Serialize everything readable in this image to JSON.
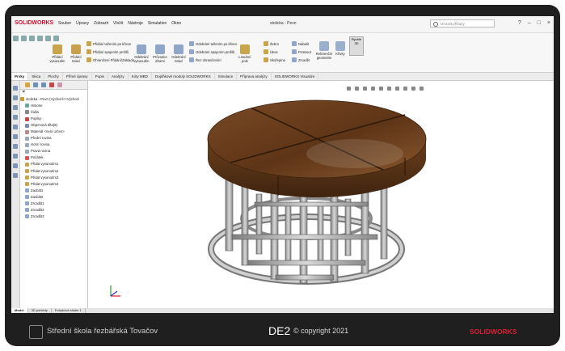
{
  "app": {
    "logo": "SOLIDWORKS",
    "title": "stolicka - Pevn",
    "menus": [
      "Soubor",
      "Úpravy",
      "Zobrazit",
      "Vložit",
      "Nástroje",
      "Simulation",
      "Okno"
    ],
    "search_placeholder": "Umístit příkazy"
  },
  "ribbon": {
    "big1": "Přidání vysunutím",
    "big2": "Přidání rotací",
    "rows1": [
      "Přidání tažením po křivce",
      "Přidání spojením profilů",
      "Ohraničení Přidání/Základu"
    ],
    "big3": "Odebrání vysunutím",
    "big4": "Průvodce dírami",
    "big5": "Odebrání rotací",
    "rows2": [
      "Odebrání tažením po křivce",
      "Odebrání spojením profilů",
      "Řez ohraničením"
    ],
    "rows3": [
      "Žebro",
      "Úkos",
      "Skořepina"
    ],
    "big6": "Lineární pole",
    "rows4": [
      "Nabalit",
      "Protnout",
      "Zrcadlit"
    ],
    "big7": "Referenční geometrie",
    "big8": "Křivky",
    "quick": "Rychlé 3D"
  },
  "tabs": [
    "Prvky",
    "Skica",
    "Plochy",
    "Přímé úpravy",
    "Popis",
    "Analýzy",
    "Kóty MBD",
    "Doplňkové moduly SOLIDWORKS",
    "Simulace",
    "Příprava analýzy",
    "SOLIDWORKS Visualize"
  ],
  "tree": [
    "stolicka - Pevn  (Výchozí<<Výchozí",
    "Historie",
    "Čidla",
    "Poplsy",
    "Objemová těla(9)",
    "Materiál <není určen>",
    "Přední rovina",
    "Horní rovina",
    "Pravá rovina",
    "Počátek",
    "Přidat vysunutím1",
    "Přidat vysunutím2",
    "Přidat vysunutím3",
    "Přidat vysunutím4",
    "Zaoblit1",
    "Zaoblit2",
    "Zrcadlit1",
    "Zrcadlit2",
    "Zrcadlit3"
  ],
  "bottom_tabs": [
    "Model",
    "3D pohledy",
    "Pohybová studie 1"
  ],
  "footer": {
    "school": "Střední škola řezbářská Tovačov",
    "code": "DE2",
    "copyright": "© copyright 2021",
    "brand": "SOLIDWORKS"
  }
}
